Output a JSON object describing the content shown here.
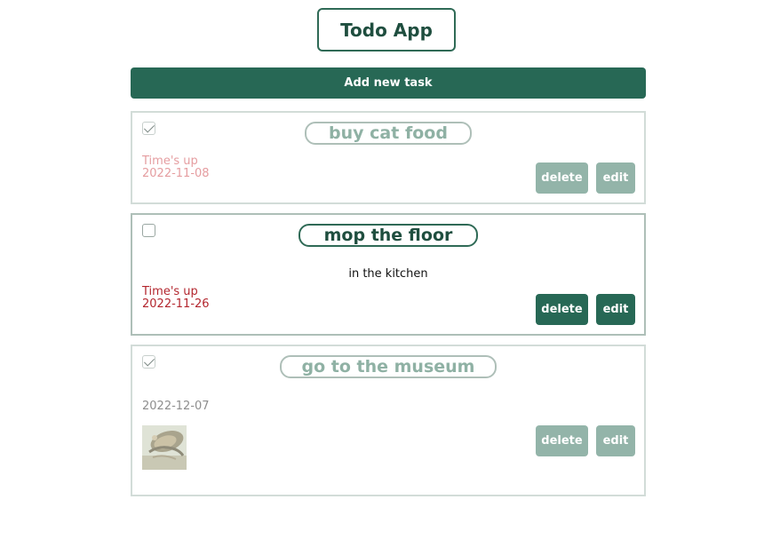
{
  "app": {
    "title": "Todo App"
  },
  "toolbar": {
    "add_label": "Add new task"
  },
  "tasks": [
    {
      "title": "buy cat food",
      "description": "",
      "status": "Time's up",
      "date": "2022-11-08",
      "completed": true,
      "delete_label": "delete",
      "edit_label": "edit"
    },
    {
      "title": "mop the floor",
      "description": "in the kitchen",
      "status": "Time's up",
      "date": "2022-11-26",
      "completed": false,
      "delete_label": "delete",
      "edit_label": "edit"
    },
    {
      "title": "go to the museum",
      "description": "",
      "status": "",
      "date": "2022-12-07",
      "completed": true,
      "delete_label": "delete",
      "edit_label": "edit",
      "image_icon": "museum-painting-thumbnail"
    }
  ],
  "colors": {
    "accent": "#276855",
    "accent_faded": "#93b4a9",
    "overdue": "#b3262e"
  }
}
